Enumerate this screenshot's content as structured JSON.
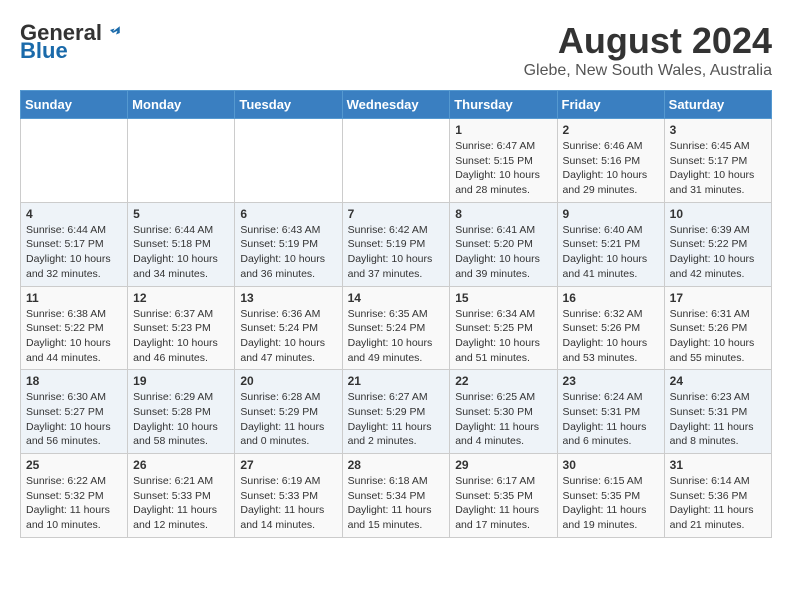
{
  "logo": {
    "general": "General",
    "blue": "Blue"
  },
  "title": "August 2024",
  "location": "Glebe, New South Wales, Australia",
  "days_of_week": [
    "Sunday",
    "Monday",
    "Tuesday",
    "Wednesday",
    "Thursday",
    "Friday",
    "Saturday"
  ],
  "weeks": [
    [
      {
        "day": "",
        "sunrise": "",
        "sunset": "",
        "daylight": ""
      },
      {
        "day": "",
        "sunrise": "",
        "sunset": "",
        "daylight": ""
      },
      {
        "day": "",
        "sunrise": "",
        "sunset": "",
        "daylight": ""
      },
      {
        "day": "",
        "sunrise": "",
        "sunset": "",
        "daylight": ""
      },
      {
        "day": "1",
        "sunrise": "Sunrise: 6:47 AM",
        "sunset": "Sunset: 5:15 PM",
        "daylight": "Daylight: 10 hours and 28 minutes."
      },
      {
        "day": "2",
        "sunrise": "Sunrise: 6:46 AM",
        "sunset": "Sunset: 5:16 PM",
        "daylight": "Daylight: 10 hours and 29 minutes."
      },
      {
        "day": "3",
        "sunrise": "Sunrise: 6:45 AM",
        "sunset": "Sunset: 5:17 PM",
        "daylight": "Daylight: 10 hours and 31 minutes."
      }
    ],
    [
      {
        "day": "4",
        "sunrise": "Sunrise: 6:44 AM",
        "sunset": "Sunset: 5:17 PM",
        "daylight": "Daylight: 10 hours and 32 minutes."
      },
      {
        "day": "5",
        "sunrise": "Sunrise: 6:44 AM",
        "sunset": "Sunset: 5:18 PM",
        "daylight": "Daylight: 10 hours and 34 minutes."
      },
      {
        "day": "6",
        "sunrise": "Sunrise: 6:43 AM",
        "sunset": "Sunset: 5:19 PM",
        "daylight": "Daylight: 10 hours and 36 minutes."
      },
      {
        "day": "7",
        "sunrise": "Sunrise: 6:42 AM",
        "sunset": "Sunset: 5:19 PM",
        "daylight": "Daylight: 10 hours and 37 minutes."
      },
      {
        "day": "8",
        "sunrise": "Sunrise: 6:41 AM",
        "sunset": "Sunset: 5:20 PM",
        "daylight": "Daylight: 10 hours and 39 minutes."
      },
      {
        "day": "9",
        "sunrise": "Sunrise: 6:40 AM",
        "sunset": "Sunset: 5:21 PM",
        "daylight": "Daylight: 10 hours and 41 minutes."
      },
      {
        "day": "10",
        "sunrise": "Sunrise: 6:39 AM",
        "sunset": "Sunset: 5:22 PM",
        "daylight": "Daylight: 10 hours and 42 minutes."
      }
    ],
    [
      {
        "day": "11",
        "sunrise": "Sunrise: 6:38 AM",
        "sunset": "Sunset: 5:22 PM",
        "daylight": "Daylight: 10 hours and 44 minutes."
      },
      {
        "day": "12",
        "sunrise": "Sunrise: 6:37 AM",
        "sunset": "Sunset: 5:23 PM",
        "daylight": "Daylight: 10 hours and 46 minutes."
      },
      {
        "day": "13",
        "sunrise": "Sunrise: 6:36 AM",
        "sunset": "Sunset: 5:24 PM",
        "daylight": "Daylight: 10 hours and 47 minutes."
      },
      {
        "day": "14",
        "sunrise": "Sunrise: 6:35 AM",
        "sunset": "Sunset: 5:24 PM",
        "daylight": "Daylight: 10 hours and 49 minutes."
      },
      {
        "day": "15",
        "sunrise": "Sunrise: 6:34 AM",
        "sunset": "Sunset: 5:25 PM",
        "daylight": "Daylight: 10 hours and 51 minutes."
      },
      {
        "day": "16",
        "sunrise": "Sunrise: 6:32 AM",
        "sunset": "Sunset: 5:26 PM",
        "daylight": "Daylight: 10 hours and 53 minutes."
      },
      {
        "day": "17",
        "sunrise": "Sunrise: 6:31 AM",
        "sunset": "Sunset: 5:26 PM",
        "daylight": "Daylight: 10 hours and 55 minutes."
      }
    ],
    [
      {
        "day": "18",
        "sunrise": "Sunrise: 6:30 AM",
        "sunset": "Sunset: 5:27 PM",
        "daylight": "Daylight: 10 hours and 56 minutes."
      },
      {
        "day": "19",
        "sunrise": "Sunrise: 6:29 AM",
        "sunset": "Sunset: 5:28 PM",
        "daylight": "Daylight: 10 hours and 58 minutes."
      },
      {
        "day": "20",
        "sunrise": "Sunrise: 6:28 AM",
        "sunset": "Sunset: 5:29 PM",
        "daylight": "Daylight: 11 hours and 0 minutes."
      },
      {
        "day": "21",
        "sunrise": "Sunrise: 6:27 AM",
        "sunset": "Sunset: 5:29 PM",
        "daylight": "Daylight: 11 hours and 2 minutes."
      },
      {
        "day": "22",
        "sunrise": "Sunrise: 6:25 AM",
        "sunset": "Sunset: 5:30 PM",
        "daylight": "Daylight: 11 hours and 4 minutes."
      },
      {
        "day": "23",
        "sunrise": "Sunrise: 6:24 AM",
        "sunset": "Sunset: 5:31 PM",
        "daylight": "Daylight: 11 hours and 6 minutes."
      },
      {
        "day": "24",
        "sunrise": "Sunrise: 6:23 AM",
        "sunset": "Sunset: 5:31 PM",
        "daylight": "Daylight: 11 hours and 8 minutes."
      }
    ],
    [
      {
        "day": "25",
        "sunrise": "Sunrise: 6:22 AM",
        "sunset": "Sunset: 5:32 PM",
        "daylight": "Daylight: 11 hours and 10 minutes."
      },
      {
        "day": "26",
        "sunrise": "Sunrise: 6:21 AM",
        "sunset": "Sunset: 5:33 PM",
        "daylight": "Daylight: 11 hours and 12 minutes."
      },
      {
        "day": "27",
        "sunrise": "Sunrise: 6:19 AM",
        "sunset": "Sunset: 5:33 PM",
        "daylight": "Daylight: 11 hours and 14 minutes."
      },
      {
        "day": "28",
        "sunrise": "Sunrise: 6:18 AM",
        "sunset": "Sunset: 5:34 PM",
        "daylight": "Daylight: 11 hours and 15 minutes."
      },
      {
        "day": "29",
        "sunrise": "Sunrise: 6:17 AM",
        "sunset": "Sunset: 5:35 PM",
        "daylight": "Daylight: 11 hours and 17 minutes."
      },
      {
        "day": "30",
        "sunrise": "Sunrise: 6:15 AM",
        "sunset": "Sunset: 5:35 PM",
        "daylight": "Daylight: 11 hours and 19 minutes."
      },
      {
        "day": "31",
        "sunrise": "Sunrise: 6:14 AM",
        "sunset": "Sunset: 5:36 PM",
        "daylight": "Daylight: 11 hours and 21 minutes."
      }
    ]
  ]
}
